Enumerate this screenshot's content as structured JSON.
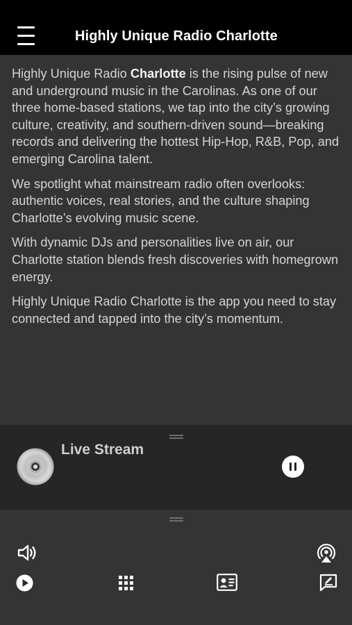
{
  "header": {
    "title": "Highly Unique Radio Charlotte",
    "menu_icon": "menu-icon"
  },
  "about": {
    "p1_before": "Highly Unique Radio ",
    "p1_bold": "Charlotte",
    "p1_after": " is the rising pulse of new and underground music in the Carolinas. As one of our three home-based stations, we tap into the city’s growing culture, creativity, and southern-driven sound—breaking records and delivering the hottest Hip-Hop, R&B, Pop, and emerging Carolina talent.",
    "p2": "We spotlight what mainstream radio often overlooks: authentic voices, real stories, and the culture shaping Charlotte’s evolving music scene.",
    "p3": "With dynamic DJs and personalities live on air, our Charlotte station blends fresh discoveries with homegrown energy.",
    "p4": "Highly Unique Radio Charlotte is the app you need to stay connected and tapped into the city’s momentum."
  },
  "player": {
    "track_label": "Live Stream",
    "artwork_icon": "cd-disc-icon",
    "control_icon": "pause-icon",
    "state": "playing"
  },
  "bottom_bar": {
    "icons": [
      "volume-icon",
      "airplay-icon",
      "play-icon",
      "grid-icon",
      "contact-card-icon",
      "feedback-icon"
    ]
  },
  "colors": {
    "topbar": "#000000",
    "background": "#343434",
    "player_bg": "#262626",
    "text": "#d4d4d4",
    "icon": "#ffffff"
  }
}
